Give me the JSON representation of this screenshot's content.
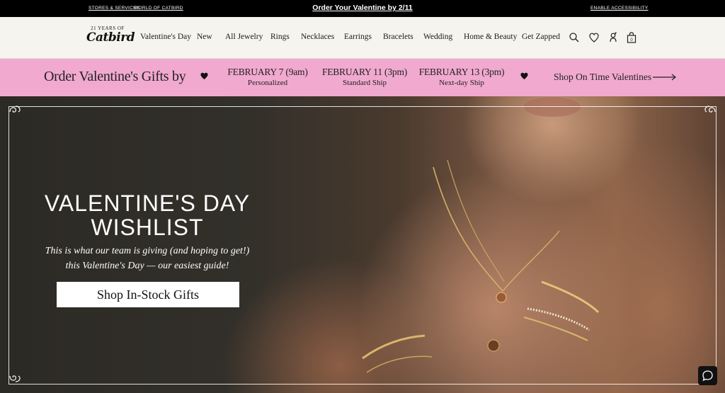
{
  "topbar": {
    "link_stores": "STORES & SERVICES",
    "link_world": "WORLD OF CATBIRD",
    "promo": "Order Your Valentine by 2/11",
    "accessibility": "ENABLE ACCESSIBILITY"
  },
  "logo": {
    "tagline": "21 YEARS OF",
    "wordmark": "Catbird"
  },
  "nav": {
    "items": [
      "Valentine's Day",
      "New",
      "All Jewelry",
      "Rings",
      "Necklaces",
      "Earrings",
      "Bracelets",
      "Wedding",
      "Home & Beauty",
      "Get Zapped"
    ]
  },
  "header_icons": [
    "search-icon",
    "heart-icon",
    "account-icon",
    "bag-icon"
  ],
  "cart_count": "0",
  "banner": {
    "lead": "Order Valentine's Gifts by",
    "deadlines": [
      {
        "date": "FEBRUARY 7 (9am)",
        "label": "Personalized"
      },
      {
        "date": "FEBRUARY 11 (3pm)",
        "label": "Standard Ship"
      },
      {
        "date": "FEBRUARY 13 (3pm)",
        "label": "Next-day Ship"
      }
    ],
    "shop_link": "Shop On Time Valentines",
    "bg_color": "#f1a9cf"
  },
  "hero": {
    "title_line1": "VALENTINE'S DAY",
    "title_line2": "WISHLIST",
    "subtitle_line1": "This is what our team is giving (and hoping to get!)",
    "subtitle_line2": "this Valentine's Day — our easiest guide!",
    "cta": "Shop In-Stock Gifts"
  },
  "chat": {
    "icon": "chat-icon"
  }
}
